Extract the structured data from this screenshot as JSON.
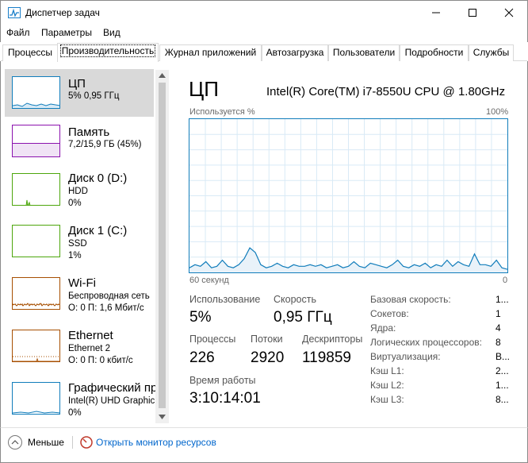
{
  "window": {
    "title": "Диспетчер задач"
  },
  "menu": [
    "Файл",
    "Параметры",
    "Вид"
  ],
  "tabs": [
    "Процессы",
    "Производительность",
    "Журнал приложений",
    "Автозагрузка",
    "Пользователи",
    "Подробности",
    "Службы"
  ],
  "active_tab": 1,
  "sidebar": [
    {
      "title": "ЦП",
      "sub1": "5% 0,95 ГГц",
      "sub2": "",
      "selected": true,
      "color": "#117dbb"
    },
    {
      "title": "Память",
      "sub1": "7,2/15,9 ГБ (45%)",
      "sub2": "",
      "selected": false,
      "color": "#8b12ae"
    },
    {
      "title": "Диск 0 (D:)",
      "sub1": "HDD",
      "sub2": "0%",
      "selected": false,
      "color": "#4da60c"
    },
    {
      "title": "Диск 1 (C:)",
      "sub1": "SSD",
      "sub2": "1%",
      "selected": false,
      "color": "#4da60c"
    },
    {
      "title": "Wi-Fi",
      "sub1": "Беспроводная сеть",
      "sub2": "О: 0 П: 1,6 Мбит/с",
      "selected": false,
      "color": "#a74f01"
    },
    {
      "title": "Ethernet",
      "sub1": "Ethernet 2",
      "sub2": "О: 0 П: 0 кбит/с",
      "selected": false,
      "color": "#a74f01"
    },
    {
      "title": "Графический пр",
      "sub1": "Intel(R) UHD Graphic",
      "sub2": "0%",
      "selected": false,
      "color": "#117dbb"
    }
  ],
  "detail": {
    "title": "ЦП",
    "model": "Intel(R) Core(TM) i7-8550U CPU @ 1.80GHz",
    "graph_label": "Используется %",
    "graph_max": "100%",
    "time_label": "60 секунд",
    "time_end": "0",
    "usage_label": "Использование",
    "usage_value": "5%",
    "speed_label": "Скорость",
    "speed_value": "0,95 ГГц",
    "processes_label": "Процессы",
    "processes_value": "226",
    "threads_label": "Потоки",
    "threads_value": "2920",
    "handles_label": "Дескрипторы",
    "handles_value": "119859",
    "uptime_label": "Время работы",
    "uptime_value": "3:10:14:01",
    "info": [
      {
        "label": "Базовая скорость:",
        "value": "1..."
      },
      {
        "label": "Сокетов:",
        "value": "1"
      },
      {
        "label": "Ядра:",
        "value": "4"
      },
      {
        "label": "Логических процессоров:",
        "value": "8"
      },
      {
        "label": "Виртуализация:",
        "value": "В..."
      },
      {
        "label": "Кэш L1:",
        "value": "2..."
      },
      {
        "label": "Кэш L2:",
        "value": "1..."
      },
      {
        "label": "Кэш L3:",
        "value": "8..."
      }
    ],
    "cpu_history": [
      3,
      5,
      4,
      7,
      3,
      4,
      8,
      4,
      3,
      5,
      9,
      16,
      13,
      5,
      3,
      4,
      6,
      4,
      3,
      5,
      4,
      4,
      5,
      4,
      5,
      3,
      4,
      5,
      3,
      4,
      7,
      4,
      3,
      6,
      5,
      4,
      3,
      5,
      8,
      4,
      3,
      5,
      4,
      6,
      3,
      5,
      4,
      8,
      4,
      7,
      5,
      4,
      12,
      5,
      5,
      4,
      8,
      3,
      2
    ]
  },
  "footer": {
    "less": "Меньше",
    "monitor": "Открыть монитор ресурсов"
  }
}
